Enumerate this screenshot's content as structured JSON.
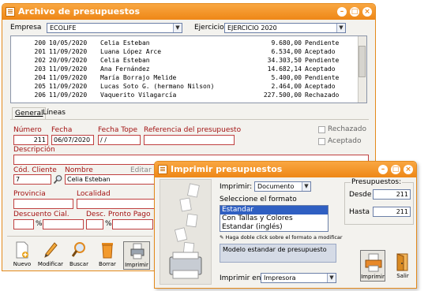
{
  "main_window": {
    "title": "Archivo de presupuestos",
    "empresa_label": "Empresa",
    "empresa_value": "ECOLIFE",
    "ejercicio_label": "Ejercicio",
    "ejercicio_value": "EJERCICIO 2020"
  },
  "list_rows": [
    {
      "num": "200",
      "date": "10/05/2020",
      "name": "Celia Esteban",
      "amount": "9.680,00",
      "status": "Pendiente"
    },
    {
      "num": "201",
      "date": "11/09/2020",
      "name": "Luana López Arce",
      "amount": "6.534,00",
      "status": "Aceptado"
    },
    {
      "num": "202",
      "date": "20/09/2020",
      "name": "Celia Esteban",
      "amount": "34.303,50",
      "status": "Pendiente"
    },
    {
      "num": "203",
      "date": "11/09/2020",
      "name": "Ana Fernández",
      "amount": "14.682,14",
      "status": "Aceptado"
    },
    {
      "num": "204",
      "date": "11/09/2020",
      "name": "María Borrajo Melide",
      "amount": "5.400,00",
      "status": "Pendiente"
    },
    {
      "num": "205",
      "date": "11/09/2020",
      "name": "Lucas Soto G. (hermano Nilson)",
      "amount": "2.464,00",
      "status": "Aceptado"
    },
    {
      "num": "206",
      "date": "11/09/2020",
      "name": "Vaquerito Vilagarcía",
      "amount": "227.500,00",
      "status": "Rechazado"
    }
  ],
  "tabs": {
    "general": "General",
    "lineas": "Líneas"
  },
  "form": {
    "numero_label": "Número",
    "numero_value": "211",
    "fecha_label": "Fecha",
    "fecha_value": "06/07/2020",
    "fecha_tope_label": "Fecha Tope",
    "fecha_tope_value": "/ /",
    "referencia_label": "Referencia del presupuesto",
    "rechazado_label": "Rechazado",
    "aceptado_label": "Aceptado",
    "descripcion_label": "Descripción",
    "cod_cliente_label": "Cód. Cliente",
    "cod_cliente_value": "7",
    "nombre_label": "Nombre",
    "nombre_value": "Celia Esteban",
    "editar_label": "Editar",
    "provincia_label": "Provincia",
    "localidad_label": "Localidad",
    "descuento_label": "Descuento Cial.",
    "pronto_pago_label": "Desc. Pronto Pago",
    "percent": "%"
  },
  "toolbar": {
    "nuevo": "Nuevo",
    "modificar": "Modificar",
    "buscar": "Buscar",
    "borrar": "Borrar",
    "imprimir": "Imprimir"
  },
  "dialog": {
    "title": "Imprimir presupuestos",
    "imprimir_label": "Imprimir:",
    "imprimir_value": "Documento",
    "formato_label": "Seleccione el formato",
    "formats": [
      "Estandar",
      "Con Tallas y Colores",
      "Estandar (inglés)"
    ],
    "hint": "Haga doble click sobre el formato a modificar",
    "description": "Modelo estandar de presupuesto",
    "imprimir_en_label": "Imprimir en",
    "imprimir_en_value": "Impresora",
    "presupuestos_label": "Presupuestos:",
    "desde_label": "Desde",
    "desde_value": "211",
    "hasta_label": "Hasta",
    "hasta_value": "211",
    "imprimir_button": "Imprimir",
    "salir_button": "Salir"
  },
  "colors": {
    "accent": "#ee8716",
    "field_border_red": "#c04040",
    "selection": "#2f5fc2"
  }
}
